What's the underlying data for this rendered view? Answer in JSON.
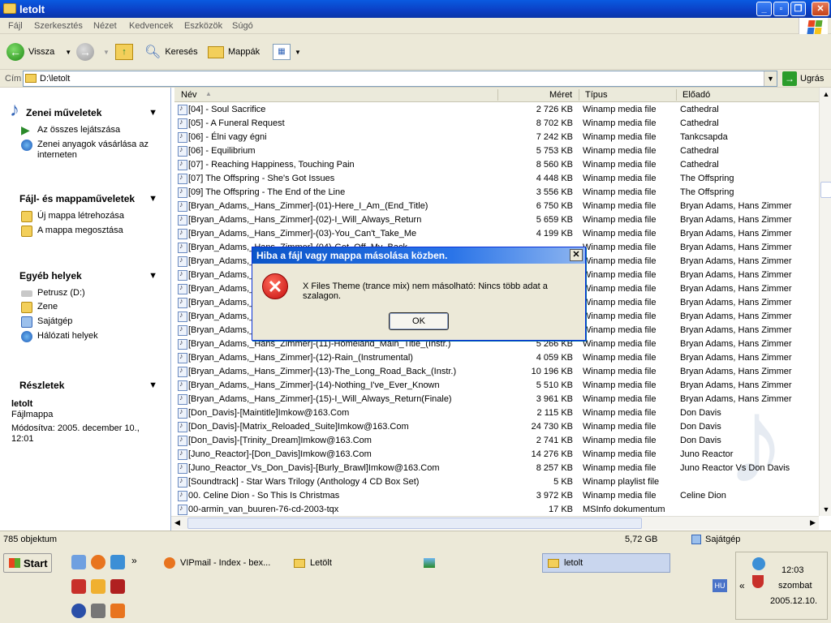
{
  "window": {
    "title": "letolt"
  },
  "menu": [
    "Fájl",
    "Szerkesztés",
    "Nézet",
    "Kedvencek",
    "Eszközök",
    "Súgó"
  ],
  "toolbar": {
    "back": "Vissza",
    "search": "Keresés",
    "folders": "Mappák"
  },
  "address": {
    "label": "Cím",
    "value": "D:\\letolt",
    "go": "Ugrás"
  },
  "sidebar": {
    "music": {
      "title": "Zenei műveletek",
      "items": [
        "Az összes lejátszása",
        "Zenei anyagok vásárlása az interneten"
      ]
    },
    "files": {
      "title": "Fájl- és mappaműveletek",
      "items": [
        "Új mappa létrehozása",
        "A mappa megosztása"
      ]
    },
    "places": {
      "title": "Egyéb helyek",
      "items": [
        "Petrusz (D:)",
        "Zene",
        "Sajátgép",
        "Hálózati helyek"
      ]
    },
    "details": {
      "title": "Részletek",
      "name": "letolt",
      "type": "Fájlmappa",
      "modified": "Módosítva: 2005. december 10., 12:01"
    }
  },
  "columns": {
    "name": "Név",
    "size": "Méret",
    "type": "Típus",
    "artist": "Előadó"
  },
  "files": [
    {
      "name": "[04] - Soul Sacrifice",
      "size": "2 726 KB",
      "type": "Winamp media file",
      "artist": "Cathedral"
    },
    {
      "name": "[05] - A Funeral Request",
      "size": "8 702 KB",
      "type": "Winamp media file",
      "artist": "Cathedral"
    },
    {
      "name": "[06] - Élni vagy égni",
      "size": "7 242 KB",
      "type": "Winamp media file",
      "artist": "Tankcsapda"
    },
    {
      "name": "[06] - Equilibrium",
      "size": "5 753 KB",
      "type": "Winamp media file",
      "artist": "Cathedral"
    },
    {
      "name": "[07] - Reaching Happiness, Touching Pain",
      "size": "8 560 KB",
      "type": "Winamp media file",
      "artist": "Cathedral"
    },
    {
      "name": "[07] The Offspring - She's Got Issues",
      "size": "4 448 KB",
      "type": "Winamp media file",
      "artist": "The Offspring"
    },
    {
      "name": "[09] The Offspring - The End of the Line",
      "size": "3 556 KB",
      "type": "Winamp media file",
      "artist": "The Offspring"
    },
    {
      "name": "[Bryan_Adams,_Hans_Zimmer]-(01)-Here_I_Am_(End_Title)",
      "size": "6 750 KB",
      "type": "Winamp media file",
      "artist": "Bryan Adams, Hans Zimmer"
    },
    {
      "name": "[Bryan_Adams,_Hans_Zimmer]-(02)-I_Will_Always_Return",
      "size": "5 659 KB",
      "type": "Winamp media file",
      "artist": "Bryan Adams, Hans Zimmer"
    },
    {
      "name": "[Bryan_Adams,_Hans_Zimmer]-(03)-You_Can't_Take_Me",
      "size": "4 199 KB",
      "type": "Winamp media file",
      "artist": "Bryan Adams, Hans Zimmer"
    },
    {
      "name": "[Bryan_Adams,_Hans_Zimmer]-(04)-Get_Off_My_Back",
      "size": "",
      "type": "Winamp media file",
      "artist": "Bryan Adams, Hans Zimmer"
    },
    {
      "name": "[Bryan_Adams,_Hans_Zimmer]",
      "size": "",
      "type": "Winamp media file",
      "artist": "Bryan Adams, Hans Zimmer"
    },
    {
      "name": "[Bryan_Adams,_Hans_Zimmer]",
      "size": "",
      "type": "Winamp media file",
      "artist": "Bryan Adams, Hans Zimmer"
    },
    {
      "name": "[Bryan_Adams,_Hans_Zimmer]",
      "size": "",
      "type": "Winamp media file",
      "artist": "Bryan Adams, Hans Zimmer"
    },
    {
      "name": "[Bryan_Adams,_Hans_Zimmer]",
      "size": "",
      "type": "Winamp media file",
      "artist": "Bryan Adams, Hans Zimmer"
    },
    {
      "name": "[Bryan_Adams,_Hans_Zimmer]",
      "size": "",
      "type": "Winamp media file",
      "artist": "Bryan Adams, Hans Zimmer"
    },
    {
      "name": "[Bryan_Adams,_Hans_Zimmer]",
      "size": "",
      "type": "Winamp media file",
      "artist": "Bryan Adams, Hans Zimmer"
    },
    {
      "name": "[Bryan_Adams,_Hans_Zimmer]-(11)-Homeland_Main_Title_(Instr.)",
      "size": "5 266 KB",
      "type": "Winamp media file",
      "artist": "Bryan Adams, Hans Zimmer"
    },
    {
      "name": "[Bryan_Adams,_Hans_Zimmer]-(12)-Rain_(Instrumental)",
      "size": "4 059 KB",
      "type": "Winamp media file",
      "artist": "Bryan Adams, Hans Zimmer"
    },
    {
      "name": "[Bryan_Adams,_Hans_Zimmer]-(13)-The_Long_Road_Back_(Instr.)",
      "size": "10 196 KB",
      "type": "Winamp media file",
      "artist": "Bryan Adams, Hans Zimmer"
    },
    {
      "name": "[Bryan_Adams,_Hans_Zimmer]-(14)-Nothing_I've_Ever_Known",
      "size": "5 510 KB",
      "type": "Winamp media file",
      "artist": "Bryan Adams, Hans Zimmer"
    },
    {
      "name": "[Bryan_Adams,_Hans_Zimmer]-(15)-I_Will_Always_Return(Finale)",
      "size": "3 961 KB",
      "type": "Winamp media file",
      "artist": "Bryan Adams, Hans Zimmer"
    },
    {
      "name": "[Don_Davis]-[Maintitle]Imkow@163.Com",
      "size": "2 115 KB",
      "type": "Winamp media file",
      "artist": "Don Davis"
    },
    {
      "name": "[Don_Davis]-[Matrix_Reloaded_Suite]Imkow@163.Com",
      "size": "24 730 KB",
      "type": "Winamp media file",
      "artist": "Don Davis"
    },
    {
      "name": "[Don_Davis]-[Trinity_Dream]Imkow@163.Com",
      "size": "2 741 KB",
      "type": "Winamp media file",
      "artist": "Don Davis"
    },
    {
      "name": "[Juno_Reactor]-[Don_Davis]Imkow@163.Com",
      "size": "14 276 KB",
      "type": "Winamp media file",
      "artist": "Juno Reactor"
    },
    {
      "name": "[Juno_Reactor_Vs_Don_Davis]-[Burly_Brawl]Imkow@163.Com",
      "size": "8 257 KB",
      "type": "Winamp media file",
      "artist": "Juno Reactor Vs Don Davis"
    },
    {
      "name": "[Soundtrack] - Star Wars Trilogy (Anthology 4 CD Box Set)",
      "size": "5 KB",
      "type": "Winamp playlist file",
      "artist": ""
    },
    {
      "name": "00. Celine Dion - So This Is Christmas",
      "size": "3 972 KB",
      "type": "Winamp media file",
      "artist": "Celine Dion"
    },
    {
      "name": "00-armin_van_buuren-76-cd-2003-tqx",
      "size": "17 KB",
      "type": "MSInfo dokumentum",
      "artist": ""
    }
  ],
  "status": {
    "count": "785 objektum",
    "size": "5,72 GB",
    "location": "Sajátgép"
  },
  "taskbar": {
    "start": "Start",
    "tasks": [
      "VIPmail - Index - bex...",
      "Letölt",
      "",
      "letolt"
    ],
    "lang": "HU",
    "time": "12:03",
    "day": "szombat",
    "date": "2005.12.10."
  },
  "dialog": {
    "title": "Hiba a  fájl vagy mappa másolása közben.",
    "message": "X Files Theme (trance mix) nem másolható: Nincs több adat a szalagon.",
    "ok": "OK"
  }
}
